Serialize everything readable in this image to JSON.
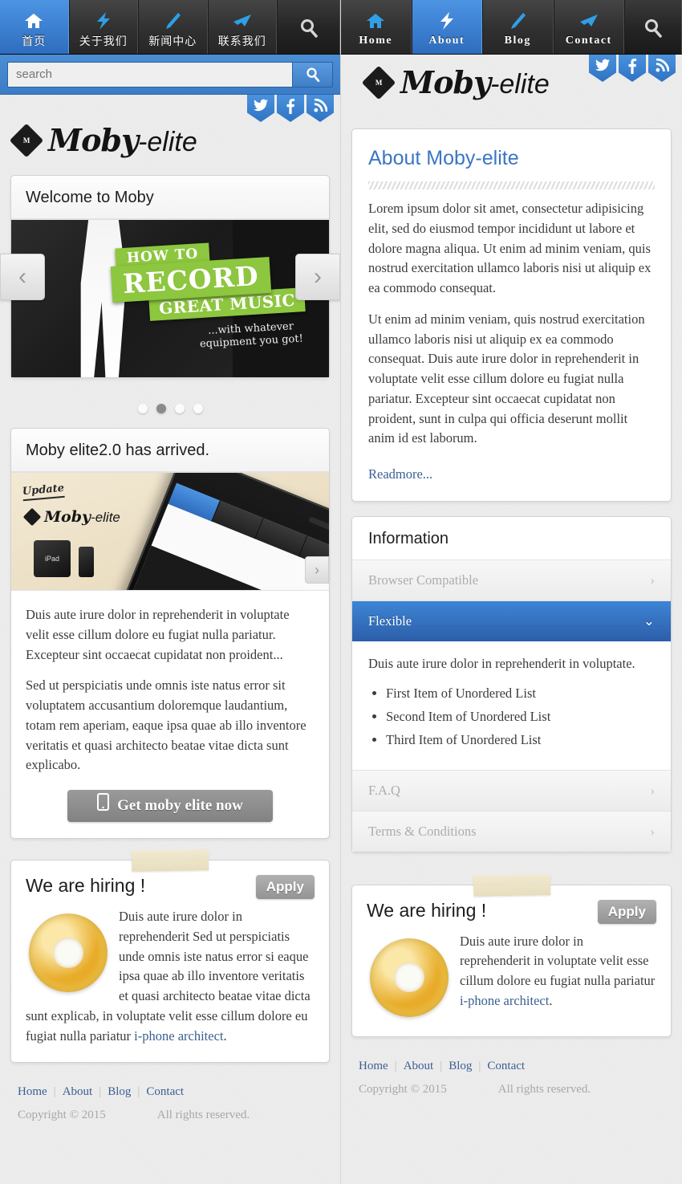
{
  "left": {
    "nav": {
      "items": [
        {
          "label": "首页",
          "icon": "home-icon",
          "active": true
        },
        {
          "label": "关于我们",
          "icon": "lightning-icon",
          "active": false
        },
        {
          "label": "新闻中心",
          "icon": "pen-icon",
          "active": false
        },
        {
          "label": "联系我们",
          "icon": "airplane-icon",
          "active": false
        }
      ],
      "search_tab_icon": "search-icon"
    },
    "search": {
      "placeholder": "search",
      "value": "",
      "button_icon": "search-icon"
    },
    "logo": {
      "badge": "M",
      "name": "Moby",
      "suffix": "-elite"
    },
    "social": [
      {
        "name": "twitter-icon",
        "glyph": "t"
      },
      {
        "name": "facebook-icon",
        "glyph": "f"
      },
      {
        "name": "rss-icon",
        "glyph": "r"
      }
    ],
    "carousel": {
      "title": "Welcome to Moby",
      "slide": {
        "banner_line1": "How to",
        "banner_line2": "Record",
        "banner_line3": "Great Music",
        "subtitle": "...with whatever equipment you got!"
      },
      "prev_label": "‹",
      "next_label": "›",
      "dots": 4,
      "active_dot": 1
    },
    "product": {
      "title": "Moby elite2.0 has arrived.",
      "image_badges": {
        "update": "Update",
        "logo_name": "Moby",
        "logo_suffix": "-elite",
        "ipad": "iPad"
      },
      "paragraph1": "Duis aute irure dolor in reprehenderit in voluptate velit esse cillum dolore eu fugiat nulla pariatur. Excepteur sint occaecat cupidatat non proident...",
      "paragraph2": "Sed ut perspiciatis unde omnis iste natus error sit voluptatem accusantium doloremque laudantium, totam rem aperiam, eaque ipsa quae ab illo inventore veritatis et quasi architecto beatae vitae dicta sunt explicabo.",
      "cta_label": "Get moby elite now",
      "cta_icon": "mobile-icon",
      "next_mini": "›"
    },
    "hiring": {
      "title": "We are hiring !",
      "apply_label": "Apply",
      "text": "Duis aute irure dolor in reprehenderit Sed ut perspiciatis unde omnis iste natus error si eaque ipsa quae ab illo inventore veritatis et quasi architecto beatae vitae dicta sunt explicab, in voluptate velit esse cillum dolore eu fugiat nulla pariatur ",
      "link": "i-phone architect",
      "text_end": "."
    },
    "footer": {
      "links": [
        "Home",
        "About",
        "Blog",
        "Contact"
      ],
      "copyright": "Copyright © 2015",
      "rights": "All rights reserved."
    }
  },
  "right": {
    "nav": {
      "items": [
        {
          "label": "Home",
          "icon": "home-icon",
          "active": false
        },
        {
          "label": "About",
          "icon": "lightning-icon",
          "active": true
        },
        {
          "label": "Blog",
          "icon": "pen-icon",
          "active": false
        },
        {
          "label": "Contact",
          "icon": "airplane-icon",
          "active": false
        }
      ],
      "search_tab_icon": "search-icon"
    },
    "logo": {
      "badge": "M",
      "name": "Moby",
      "suffix": "-elite"
    },
    "social": [
      {
        "name": "twitter-icon",
        "glyph": "t"
      },
      {
        "name": "facebook-icon",
        "glyph": "f"
      },
      {
        "name": "rss-icon",
        "glyph": "r"
      }
    ],
    "about": {
      "title": "About Moby-elite",
      "paragraph1": "Lorem ipsum dolor sit amet, consectetur adipisicing elit, sed do eiusmod tempor incididunt ut labore et dolore magna aliqua. Ut enim ad minim veniam, quis nostrud exercitation ullamco laboris nisi ut aliquip ex ea commodo consequat.",
      "paragraph2": "Ut enim ad minim veniam, quis nostrud exercitation ullamco laboris nisi ut aliquip ex ea commodo consequat. Duis aute irure dolor in reprehenderit in voluptate velit esse cillum dolore eu fugiat nulla pariatur. Excepteur sint occaecat cupidatat non proident, sunt in culpa qui officia deserunt mollit anim id est laborum.",
      "readmore": "Readmore..."
    },
    "information": {
      "title": "Information",
      "items": [
        {
          "label": "Browser Compatible",
          "open": false,
          "chevron": "›"
        },
        {
          "label": "Flexible",
          "open": true,
          "chevron": "⌄",
          "body": "Duis aute irure dolor in reprehenderit in voluptate.",
          "list": [
            "First Item of Unordered List",
            "Second Item of Unordered List",
            "Third Item of Unordered List"
          ]
        },
        {
          "label": "F.A.Q",
          "open": false,
          "chevron": "›"
        },
        {
          "label": "Terms & Conditions",
          "open": false,
          "chevron": "›"
        }
      ]
    },
    "hiring": {
      "title": "We are hiring !",
      "apply_label": "Apply",
      "text": "Duis aute irure dolor in reprehenderit in voluptate velit esse cillum dolore eu fugiat nulla pariatur ",
      "link": "i-phone architect",
      "text_end": "."
    },
    "footer": {
      "links": [
        "Home",
        "About",
        "Blog",
        "Contact"
      ],
      "copyright": "Copyright © 2015",
      "rights": "All rights reserved."
    }
  },
  "colors": {
    "accent_blue": "#3d85d6",
    "accent_blue_dark": "#2c5ea8",
    "nav_dark": "#2b2b2b",
    "banner_green": "#8dc63f",
    "link_blue": "#3a5f93"
  }
}
